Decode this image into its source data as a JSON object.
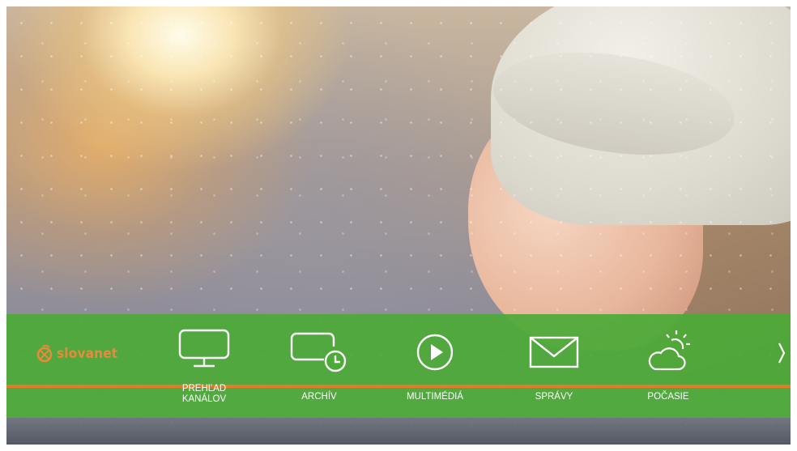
{
  "brand": {
    "logo_text": "slovanet",
    "colors": {
      "bar_green": "#4caa38",
      "stripe_orange": "#e37b2a",
      "logo_orange": "#e9893a",
      "icon_white": "#ffffff"
    }
  },
  "menu": {
    "items": [
      {
        "label_line1": "PREHĽAD",
        "label_line2": "KANÁLOV",
        "icon": "tv-icon"
      },
      {
        "label": "ARCHÍV",
        "icon": "archive-clock-icon"
      },
      {
        "label": "MULTIMÉDIÁ",
        "icon": "play-icon"
      },
      {
        "label": "SPRÁVY",
        "icon": "mail-icon"
      },
      {
        "label": "POČASIE",
        "icon": "weather-icon"
      }
    ],
    "next_icon": "chevron-right-icon"
  }
}
